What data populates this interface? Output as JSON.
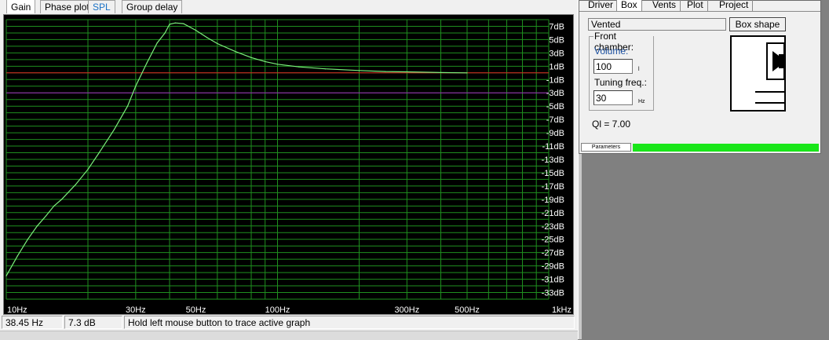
{
  "tabs": [
    {
      "label": "Gain",
      "active": true
    },
    {
      "label": "Phase plot",
      "active": false
    },
    {
      "label": "SPL",
      "active": false
    },
    {
      "label": "Group delay",
      "active": false
    }
  ],
  "status": {
    "freq": "38.45 Hz",
    "gain": "7.3 dB",
    "hint": "Hold left mouse button to trace active graph"
  },
  "box_panel": {
    "tabs": [
      {
        "label": "Driver",
        "active": false
      },
      {
        "label": "Box",
        "active": true
      },
      {
        "label": "Vents",
        "active": false
      },
      {
        "label": "Plot",
        "active": false
      },
      {
        "label": "Project",
        "active": false
      }
    ],
    "box_type": "Vented",
    "box_shape_label": "Box shape",
    "front_chamber_label": "Front chamber:",
    "volume_label": "Volume:",
    "volume_value": "100",
    "volume_unit": "l",
    "tuning_label": "Tuning freq.:",
    "tuning_value": "30",
    "tuning_unit": "Hz",
    "ql_text": "Ql = 7.00",
    "parameters_label": "Parameters",
    "progress_fraction": 1.0
  },
  "colors": {
    "plot_bg": "#000000",
    "grid": "#1f8f1f",
    "curve": "#7cf07c",
    "ref_0db": "#e02020",
    "ref_m3db": "#a020c0",
    "axis_text": "#ffffff",
    "progress": "#19e619"
  },
  "chart_data": {
    "type": "line",
    "title": "",
    "xlabel": "",
    "ylabel": "",
    "x_scale": "log",
    "xlim": [
      10,
      1000
    ],
    "ylim": [
      -34,
      8
    ],
    "x_tick_labels": [
      {
        "value": 10,
        "label": "10Hz"
      },
      {
        "value": 30,
        "label": "30Hz"
      },
      {
        "value": 50,
        "label": "50Hz"
      },
      {
        "value": 100,
        "label": "100Hz"
      },
      {
        "value": 300,
        "label": "300Hz"
      },
      {
        "value": 500,
        "label": "500Hz"
      },
      {
        "value": 1000,
        "label": "1kHz"
      }
    ],
    "y_ticks": [
      7,
      5,
      3,
      1,
      -1,
      -3,
      -5,
      -7,
      -9,
      -11,
      -13,
      -15,
      -17,
      -19,
      -21,
      -23,
      -25,
      -27,
      -29,
      -31,
      -33
    ],
    "y_tick_labels": [
      "7dB",
      "5dB",
      "3dB",
      "1dB",
      "-1dB",
      "-3dB",
      "-5dB",
      "-7dB",
      "-9dB",
      "-11dB",
      "-13dB",
      "-15dB",
      "-17dB",
      "-19dB",
      "-21dB",
      "-23dB",
      "-25dB",
      "-27dB",
      "-29dB",
      "-31dB",
      "-33dB"
    ],
    "reference_lines": [
      {
        "y": 0,
        "color": "#e02020"
      },
      {
        "y": -3,
        "color": "#a020c0"
      }
    ],
    "grid": true,
    "series": [
      {
        "x": [
          10,
          11,
          12,
          13,
          14,
          15,
          16,
          18,
          20,
          22,
          25,
          28,
          30,
          33,
          36,
          38.45,
          40,
          42,
          45,
          50,
          55,
          60,
          70,
          80,
          90,
          100,
          120,
          150,
          200,
          250,
          300,
          400,
          500
        ],
        "y": [
          -30.5,
          -27.5,
          -25,
          -23,
          -21.5,
          -20,
          -19,
          -16.8,
          -14.5,
          -12,
          -8.5,
          -5,
          -2,
          1.5,
          4.5,
          6.0,
          7.3,
          7.5,
          7.4,
          6.4,
          5.3,
          4.4,
          3.2,
          2.3,
          1.7,
          1.3,
          0.9,
          0.6,
          0.35,
          0.2,
          0.15,
          0.05,
          0.0
        ]
      }
    ]
  }
}
